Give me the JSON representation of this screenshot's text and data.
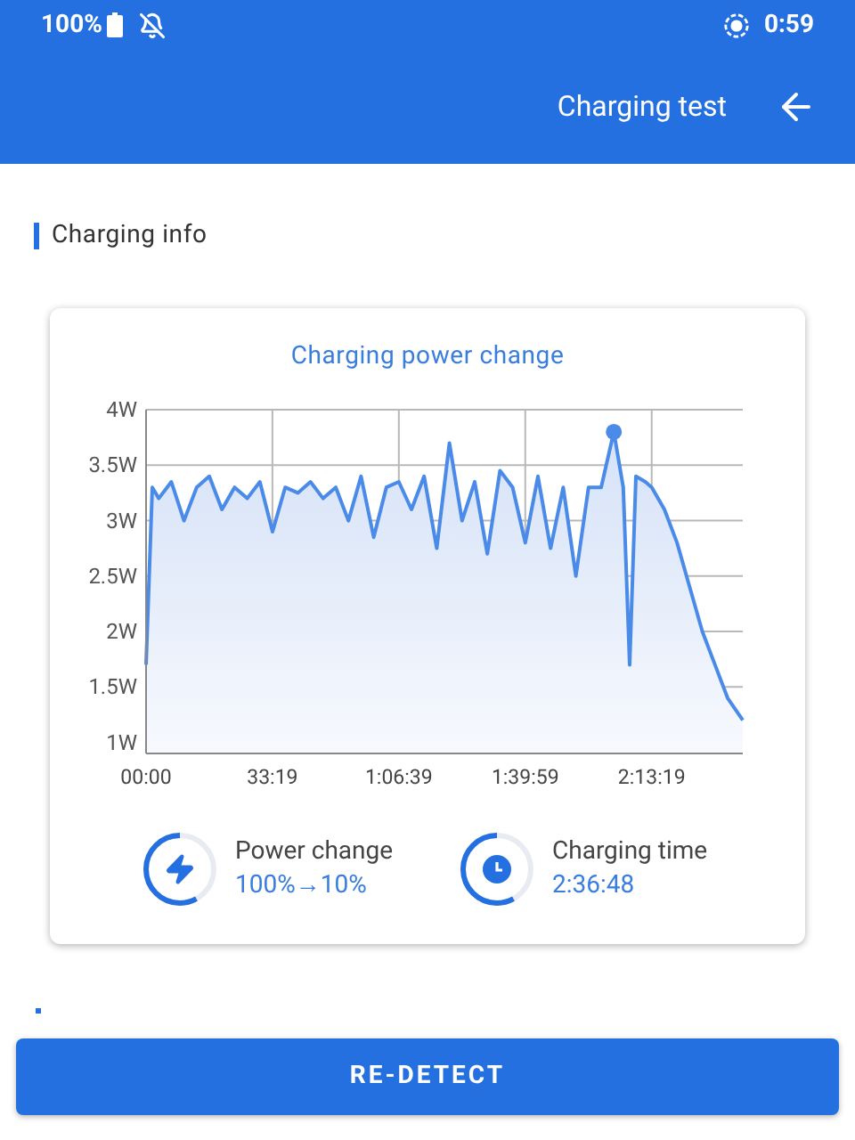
{
  "status_bar": {
    "battery": "100%",
    "time": "0:59"
  },
  "header": {
    "title": "Charging test"
  },
  "section": {
    "title": "Charging info"
  },
  "card": {
    "chart_data": {
      "type": "area",
      "title": "Charging power change",
      "x": [
        0,
        100,
        200,
        400,
        600,
        800,
        1000,
        1200,
        1400,
        1600,
        1800,
        2000,
        2200,
        2400,
        2600,
        2800,
        3000,
        3200,
        3400,
        3600,
        3800,
        4000,
        4200,
        4400,
        4600,
        4800,
        5000,
        5200,
        5400,
        5600,
        5800,
        6000,
        6200,
        6400,
        6600,
        6800,
        7000,
        7200,
        7400,
        7550,
        7650,
        7750,
        7900,
        8000,
        8200,
        8400,
        8600,
        8800,
        9000,
        9200,
        9440
      ],
      "series": [
        {
          "color": "#4a8ae8",
          "values": [
            1.7,
            3.3,
            3.2,
            3.35,
            3.0,
            3.3,
            3.4,
            3.1,
            3.3,
            3.2,
            3.35,
            2.9,
            3.3,
            3.25,
            3.35,
            3.2,
            3.3,
            3.0,
            3.4,
            2.85,
            3.3,
            3.35,
            3.1,
            3.4,
            2.75,
            3.7,
            3.0,
            3.35,
            2.7,
            3.45,
            3.3,
            2.8,
            3.4,
            2.75,
            3.3,
            2.5,
            3.3,
            3.3,
            3.8,
            3.3,
            1.7,
            3.4,
            3.35,
            3.3,
            3.1,
            2.8,
            2.4,
            2.0,
            1.7,
            1.4,
            1.2
          ]
        }
      ],
      "grid": true,
      "xlim": [
        0,
        9440
      ],
      "ylim": [
        0.9,
        4
      ],
      "xticks": [
        {
          "value": 0,
          "label": "00:00"
        },
        {
          "value": 1999,
          "label": "33:19"
        },
        {
          "value": 3999,
          "label": "1:06:39"
        },
        {
          "value": 5999,
          "label": "1:39:59"
        },
        {
          "value": 7999,
          "label": "2:13:19"
        }
      ],
      "yticks": [
        {
          "value": 1,
          "label": "1W"
        },
        {
          "value": 1.5,
          "label": "1.5W"
        },
        {
          "value": 2,
          "label": "2W"
        },
        {
          "value": 2.5,
          "label": "2.5W"
        },
        {
          "value": 3,
          "label": "3W"
        },
        {
          "value": 3.5,
          "label": "3.5W"
        },
        {
          "value": 4,
          "label": "4W"
        }
      ]
    },
    "stats": [
      {
        "kind": "power",
        "label": "Power change",
        "value": "100%→10%"
      },
      {
        "kind": "time",
        "label": "Charging time",
        "value": "2:36:48"
      }
    ]
  },
  "button": {
    "label": "RE-DETECT"
  }
}
